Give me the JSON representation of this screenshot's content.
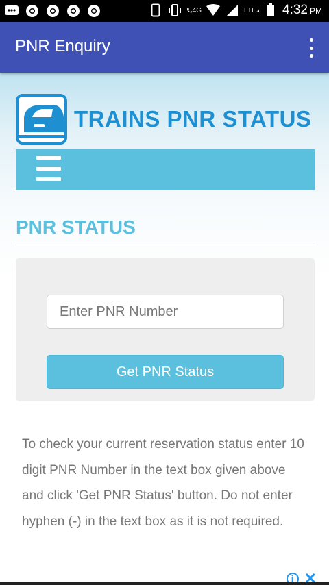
{
  "status_bar": {
    "time": "4:32",
    "ampm": "PM",
    "network_label": "4G",
    "lte_label": "LTE"
  },
  "app_bar": {
    "title": "PNR Enquiry"
  },
  "site": {
    "logo_text": "TRAINS PNR STATUS",
    "section_title": "PNR STATUS"
  },
  "form": {
    "input_placeholder": "Enter PNR Number",
    "input_value": "",
    "button_label": "Get PNR Status"
  },
  "info_text": "To check your current reservation status enter 10 digit PNR Number in the text box given above and click 'Get PNR Status' button. Do not enter hyphen (-) in the text box as it is not required.",
  "colors": {
    "app_bar": "#3f51b5",
    "accent": "#5bc0de",
    "logo": "#1e8fd1",
    "panel": "#eeeeee"
  }
}
